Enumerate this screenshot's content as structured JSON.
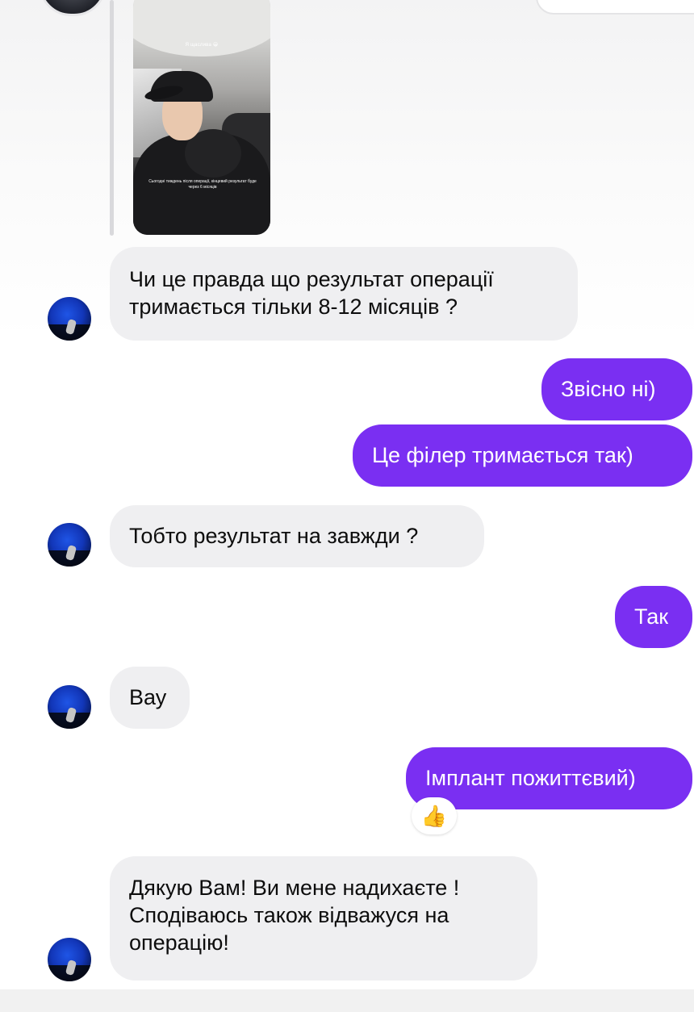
{
  "story": {
    "caption_top": "Я щаслива 😁",
    "caption_bottom": "Сьогодні тиждень після операції, кінцевий результат буде через 6 місяців"
  },
  "messages": [
    {
      "id": "m1",
      "direction": "incoming",
      "lines": [
        "Чи це правда що результат операції",
        "тримається тільки 8-12 місяців ?"
      ]
    },
    {
      "id": "m2",
      "direction": "outgoing",
      "lines": [
        "Звісно ні)"
      ]
    },
    {
      "id": "m3",
      "direction": "outgoing",
      "lines": [
        "Це філер тримається так)"
      ]
    },
    {
      "id": "m4",
      "direction": "incoming",
      "lines": [
        "Тобто результат на завжди ?"
      ]
    },
    {
      "id": "m5",
      "direction": "outgoing",
      "lines": [
        "Так"
      ]
    },
    {
      "id": "m6",
      "direction": "incoming",
      "lines": [
        "Вау"
      ]
    },
    {
      "id": "m7",
      "direction": "outgoing",
      "lines": [
        "Імплант пожиттєвий)"
      ],
      "reaction": "👍"
    },
    {
      "id": "m8",
      "direction": "incoming",
      "lines": [
        "Дякую Вам! Ви мене надихаєте !",
        "Сподіваюсь також відважуся на",
        "операцію!"
      ]
    }
  ],
  "colors": {
    "outgoing_bubble": "#7a2ff2",
    "incoming_bubble": "#efeff1",
    "avatar": "#1236b8"
  },
  "icons": {
    "reaction": "thumbs-up-icon",
    "sender_avatar": "avatar"
  }
}
